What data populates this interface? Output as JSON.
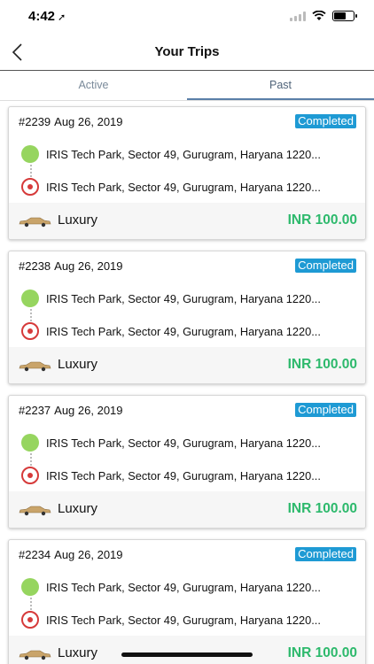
{
  "status_bar": {
    "time": "4:42"
  },
  "header": {
    "title": "Your Trips"
  },
  "tabs": [
    {
      "label": "Active"
    },
    {
      "label": "Past"
    }
  ],
  "colors": {
    "badge": "#1e9ad4",
    "price": "#2db96c",
    "pickup": "#96d55f",
    "drop": "#d63a3a"
  },
  "trips": [
    {
      "id": "#2239",
      "date": "Aug 26, 2019",
      "status": "Completed",
      "pickup": "IRIS Tech Park, Sector 49, Gurugram, Haryana 1220...",
      "drop": "IRIS Tech Park, Sector 49, Gurugram, Haryana 1220...",
      "car_type": "Luxury",
      "price": "INR 100.00"
    },
    {
      "id": "#2238",
      "date": "Aug 26, 2019",
      "status": "Completed",
      "pickup": "IRIS Tech Park, Sector 49, Gurugram, Haryana 1220...",
      "drop": "IRIS Tech Park, Sector 49, Gurugram, Haryana 1220...",
      "car_type": "Luxury",
      "price": "INR 100.00"
    },
    {
      "id": "#2237",
      "date": "Aug 26, 2019",
      "status": "Completed",
      "pickup": "IRIS Tech Park, Sector 49, Gurugram, Haryana 1220...",
      "drop": "IRIS Tech Park, Sector 49, Gurugram, Haryana 1220...",
      "car_type": "Luxury",
      "price": "INR 100.00"
    },
    {
      "id": "#2234",
      "date": "Aug 26, 2019",
      "status": "Completed",
      "pickup": "IRIS Tech Park, Sector 49, Gurugram, Haryana 1220...",
      "drop": "IRIS Tech Park, Sector 49, Gurugram, Haryana 1220...",
      "car_type": "Luxury",
      "price": "INR 100.00"
    }
  ]
}
